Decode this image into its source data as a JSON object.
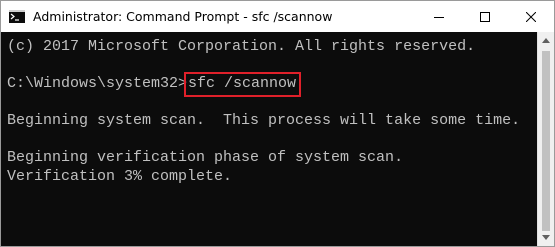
{
  "window": {
    "title": "Administrator: Command Prompt - sfc  /scannow"
  },
  "icons": {
    "app": "cmd-app-icon",
    "minimize": "minimize-icon",
    "maximize": "maximize-icon",
    "close": "close-icon",
    "scroll_up": "scroll-up-arrow-icon",
    "scroll_down": "scroll-down-arrow-icon"
  },
  "terminal": {
    "line1": "(c) 2017 Microsoft Corporation. All rights reserved.",
    "prompt": "C:\\Windows\\system32>",
    "command": "sfc /scannow",
    "line3": "Beginning system scan.  This process will take some time.",
    "line4": "Beginning verification phase of system scan.",
    "line5": "Verification 3% complete."
  },
  "colors": {
    "background": "#0c0c0c",
    "text": "#c0c0c0",
    "highlight": "#e0202a"
  }
}
